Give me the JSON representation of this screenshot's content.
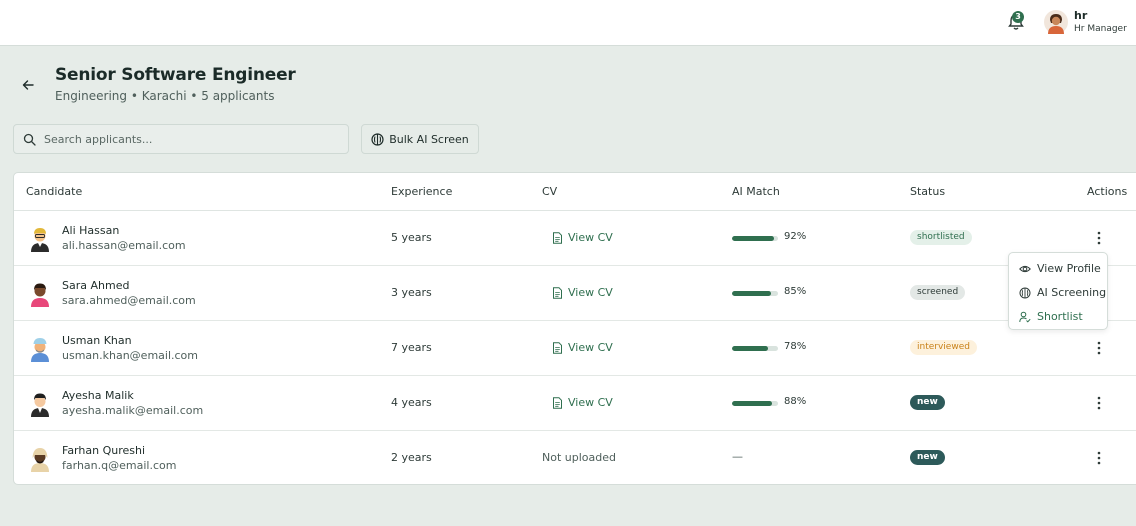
{
  "header": {
    "notification_count": "3",
    "user_name": "hr",
    "user_role": "Hr Manager"
  },
  "job": {
    "title": "Senior Software Engineer",
    "subtitle": "Engineering • Karachi • 5 applicants"
  },
  "toolbar": {
    "search_placeholder": "Search applicants...",
    "bulk_label": "Bulk AI Screen"
  },
  "table": {
    "columns": [
      "Candidate",
      "Experience",
      "CV",
      "AI Match",
      "Status",
      "Actions"
    ],
    "rows": [
      {
        "name": "Ali Hassan",
        "email": "ali.hassan@email.com",
        "experience": "5 years",
        "cv": "View CV",
        "match": 92,
        "match_label": "92%",
        "status": "shortlisted"
      },
      {
        "name": "Sara Ahmed",
        "email": "sara.ahmed@email.com",
        "experience": "3 years",
        "cv": "View CV",
        "match": 85,
        "match_label": "85%",
        "status": "screened"
      },
      {
        "name": "Usman Khan",
        "email": "usman.khan@email.com",
        "experience": "7 years",
        "cv": "View CV",
        "match": 78,
        "match_label": "78%",
        "status": "interviewed"
      },
      {
        "name": "Ayesha Malik",
        "email": "ayesha.malik@email.com",
        "experience": "4 years",
        "cv": "View CV",
        "match": 88,
        "match_label": "88%",
        "status": "new"
      },
      {
        "name": "Farhan Qureshi",
        "email": "farhan.q@email.com",
        "experience": "2 years",
        "cv": "Not uploaded",
        "match_label": "—",
        "status": "new"
      }
    ]
  },
  "dropdown": {
    "items": [
      "View Profile",
      "AI Screening",
      "Shortlist"
    ]
  },
  "colors": {
    "accent": "#2f6f4f",
    "background": "#e6ece8",
    "badge_new": "#2d5a5a",
    "badge_interviewed": "#c9821b"
  },
  "icons": {
    "notifications": "bell-icon",
    "back": "arrow-left-icon",
    "search": "search-icon",
    "bulk": "brain-icon",
    "cv": "document-icon",
    "actions": "kebab-menu-icon",
    "view_profile": "eye-icon",
    "ai_screening": "brain-icon",
    "shortlist": "user-check-icon"
  }
}
